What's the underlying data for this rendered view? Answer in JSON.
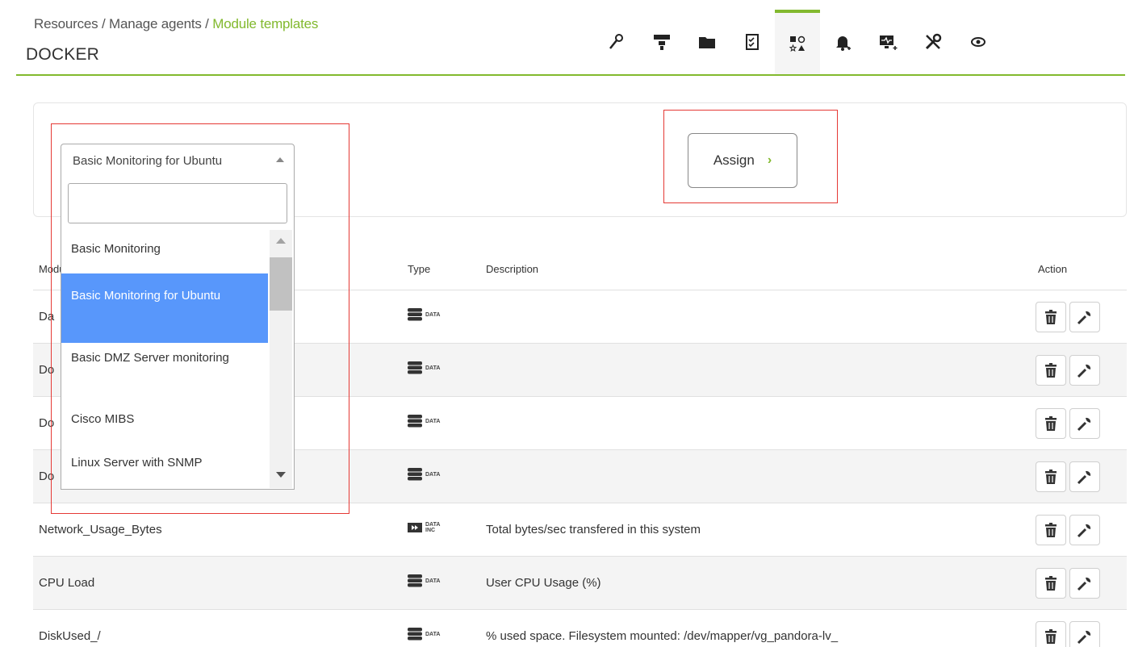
{
  "header": {
    "breadcrumb": [
      "Resources",
      "Manage agents",
      "Module templates"
    ],
    "title": "DOCKER",
    "tabs": [
      {
        "icon": "wrench-icon"
      },
      {
        "icon": "network-icon"
      },
      {
        "icon": "folder-icon"
      },
      {
        "icon": "checklist-icon"
      },
      {
        "icon": "shapes-icon",
        "active": true
      },
      {
        "icon": "bell-plus-icon"
      },
      {
        "icon": "monitor-plus-icon"
      },
      {
        "icon": "tools-icon"
      },
      {
        "icon": "eye-icon"
      }
    ]
  },
  "template_select": {
    "selected": "Basic Monitoring for Ubuntu",
    "options": [
      "Basic Monitoring",
      "Basic Monitoring for Ubuntu",
      "Basic DMZ Server monitoring",
      "Cisco MIBS",
      "Linux Server with SNMP"
    ],
    "search_value": ""
  },
  "assign_button": {
    "label": "Assign",
    "icon": "chevron-right-icon"
  },
  "table": {
    "headers": {
      "module": "Module",
      "type": "Type",
      "description": "Description",
      "action": "Action"
    },
    "rows": [
      {
        "name": "Da",
        "type": "DATA",
        "description": ""
      },
      {
        "name": "Do",
        "type": "DATA",
        "description": ""
      },
      {
        "name": "Do",
        "type": "DATA",
        "description": ""
      },
      {
        "name": "Do",
        "type": "DATA",
        "description": ""
      },
      {
        "name": "Network_Usage_Bytes",
        "type": "DATA INC",
        "description": "Total bytes/sec transfered in this system"
      },
      {
        "name": "CPU Load",
        "type": "DATA",
        "description": "User CPU Usage (%)"
      },
      {
        "name": "DiskUsed_/",
        "type": "DATA",
        "description": "% used space. Filesystem mounted: /dev/mapper/vg_pandora-lv_"
      }
    ]
  },
  "colors": {
    "accent": "#82b92e",
    "highlight": "#e53935",
    "selected_option": "#5897fb"
  }
}
